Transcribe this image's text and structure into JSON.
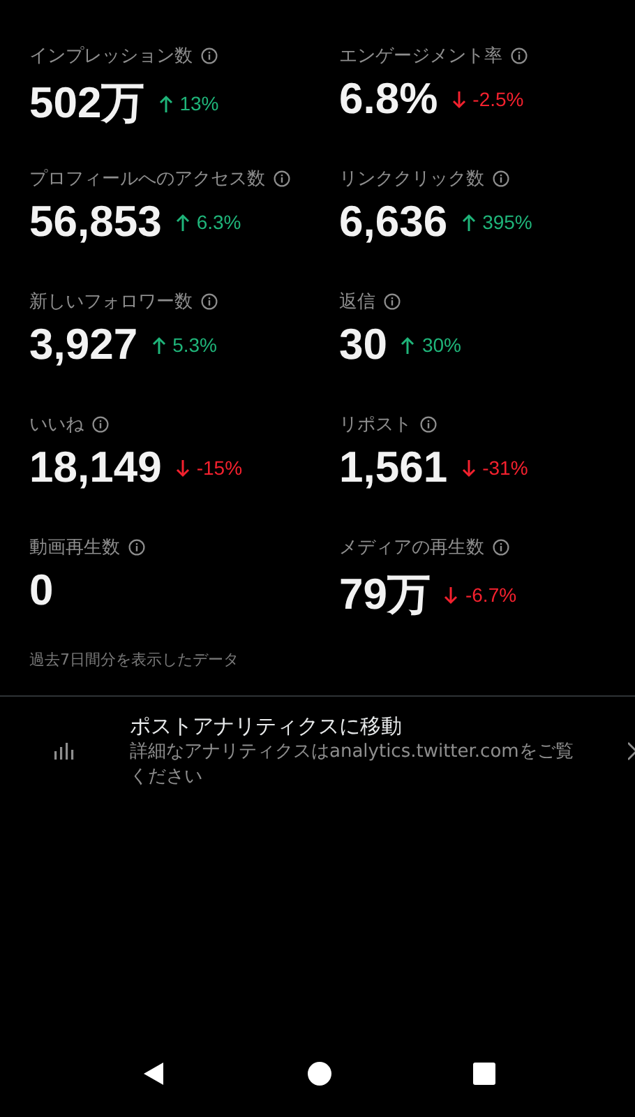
{
  "metrics": [
    {
      "label": "インプレッション数",
      "value": "502万",
      "change": "13%",
      "increase": true
    },
    {
      "label": "エンゲージメント率",
      "value": "6.8%",
      "change": "-2.5%",
      "increase": false
    },
    {
      "label": "プロフィールへのアクセス数",
      "value": "56,853",
      "change": "6.3%",
      "increase": true
    },
    {
      "label": "リンククリック数",
      "value": "6,636",
      "change": "395%",
      "increase": true
    },
    {
      "label": "新しいフォロワー数",
      "value": "3,927",
      "change": "5.3%",
      "increase": true
    },
    {
      "label": "返信",
      "value": "30",
      "change": "30%",
      "increase": true
    },
    {
      "label": "いいね",
      "value": "18,149",
      "change": "-15%",
      "increase": false
    },
    {
      "label": "リポスト",
      "value": "1,561",
      "change": "-31%",
      "increase": false
    },
    {
      "label": "動画再生数",
      "value": "0"
    },
    {
      "label": "メディアの再生数",
      "value": "79万",
      "change": "-6.7%",
      "increase": false
    }
  ],
  "period_note": "過去7日間分を表示したデータ",
  "analytics_link": {
    "title": "ポストアナリティクスに移動",
    "description": "詳細なアナリティクスはanalytics.twitter.comをご覧ください"
  }
}
